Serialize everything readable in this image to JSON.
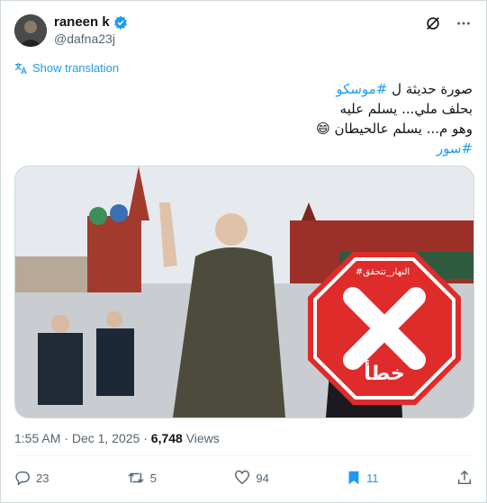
{
  "author": {
    "name": "raneen k",
    "handle": "@dafna23j"
  },
  "translate_label": "Show translation",
  "tweet": {
    "line1_text": "صورة حديثة ل",
    "line1_hashtag": "#موسكو",
    "line2": "بحلف ملي... يسلم عليه",
    "line3": "وهو م... يسلم عالحيطان 😄",
    "line4_hashtag": "#سور"
  },
  "stamp": {
    "brand": "#النهار_تتحقق",
    "label": "خطأ"
  },
  "meta": {
    "time": "1:55 AM",
    "date": "Dec 1, 2025",
    "views_count": "6,748",
    "views_label": "Views",
    "sep": "·"
  },
  "actions": {
    "replies": "23",
    "reposts": "5",
    "likes": "94",
    "bookmarks": "11"
  },
  "colors": {
    "accent": "#1d9bf0",
    "stamp_red": "#e02b2b"
  },
  "icons": [
    "verified-badge-icon",
    "grok-icon",
    "more-icon",
    "translate-icon",
    "reply-icon",
    "repost-icon",
    "like-icon",
    "bookmark-icon",
    "share-icon"
  ]
}
